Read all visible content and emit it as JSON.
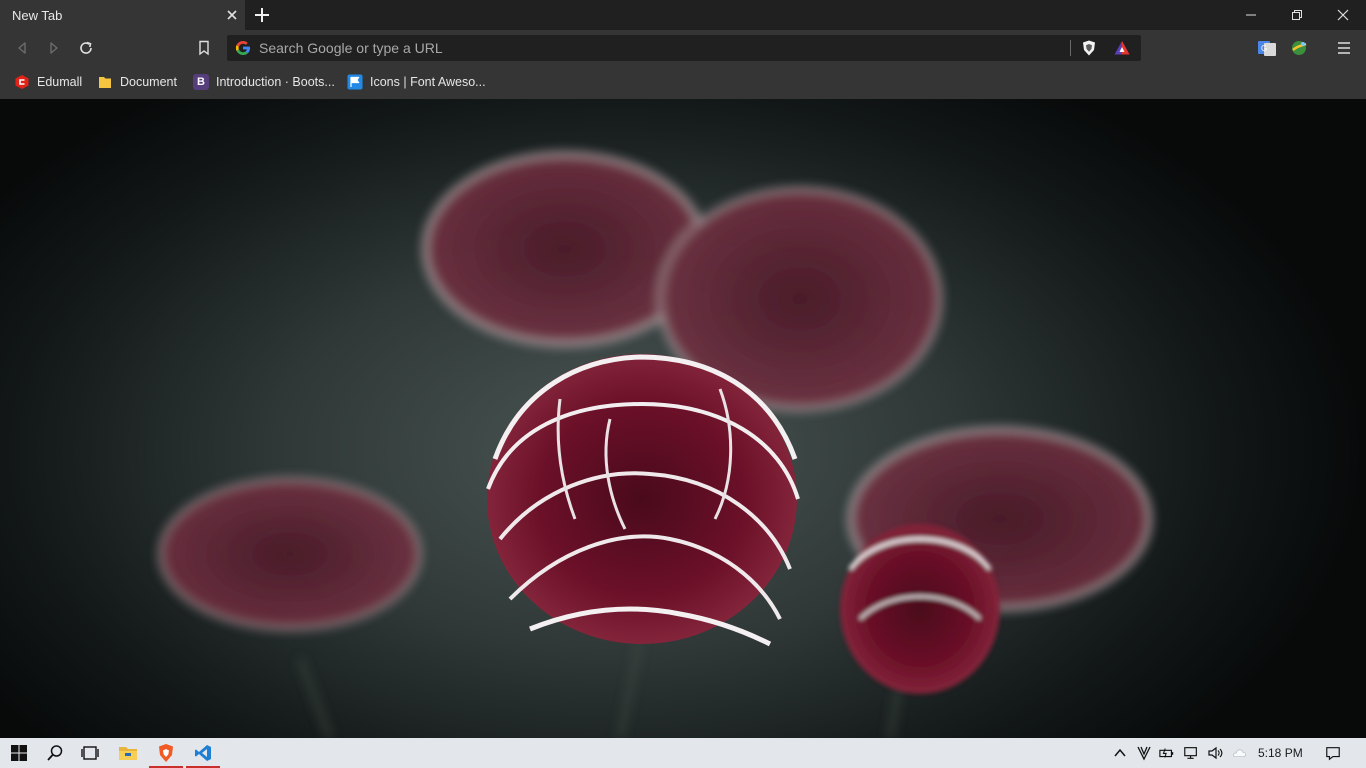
{
  "tab": {
    "title": "New Tab"
  },
  "omnibox": {
    "placeholder": "Search Google or type a URL",
    "value": ""
  },
  "bookmarks": [
    {
      "label": "Edumall",
      "icon": "edumall-icon"
    },
    {
      "label": "Document",
      "icon": "folder-icon"
    },
    {
      "label": "Introduction · Boots...",
      "icon": "bootstrap-icon"
    },
    {
      "label": "Icons | Font Aweso...",
      "icon": "fontawesome-flag-icon"
    }
  ],
  "bootstrap_letter": "B",
  "colors": {
    "accent": "#c9302c",
    "tab_bg": "#353535",
    "toolbar_bg": "#353535",
    "taskbar_bg": "#e3e7ec"
  },
  "taskbar": {
    "apps": [
      "windows-start-icon",
      "search-icon",
      "task-view-icon",
      "file-explorer-icon",
      "brave-browser-icon",
      "vscode-icon"
    ],
    "time": "5:18 PM"
  }
}
